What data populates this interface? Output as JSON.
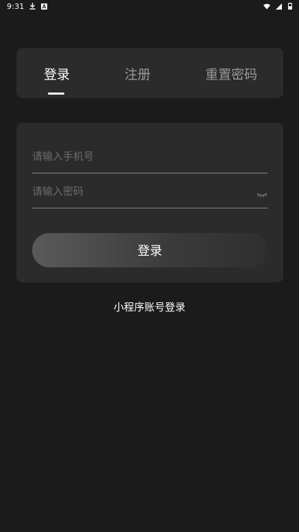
{
  "status_bar": {
    "time": "9:31",
    "left_icons": [
      "download-icon",
      "a-notification-icon"
    ],
    "right_icons": [
      "wifi-icon",
      "signal-icon",
      "battery-icon"
    ]
  },
  "tabs": {
    "login": "登录",
    "register": "注册",
    "reset_password": "重置密码",
    "active": "login"
  },
  "form": {
    "phone_placeholder": "请输入手机号",
    "phone_value": "",
    "password_placeholder": "请输入密码",
    "password_value": "",
    "password_toggle_icon": "eye-closed-icon",
    "login_button": "登录"
  },
  "mini_program_login": "小程序账号登录",
  "colors": {
    "background": "#1b1b1b",
    "card": "#2b2b2b",
    "text": "#ffffff",
    "muted_text": "#9a9a9a",
    "placeholder": "#6c6c6c"
  }
}
